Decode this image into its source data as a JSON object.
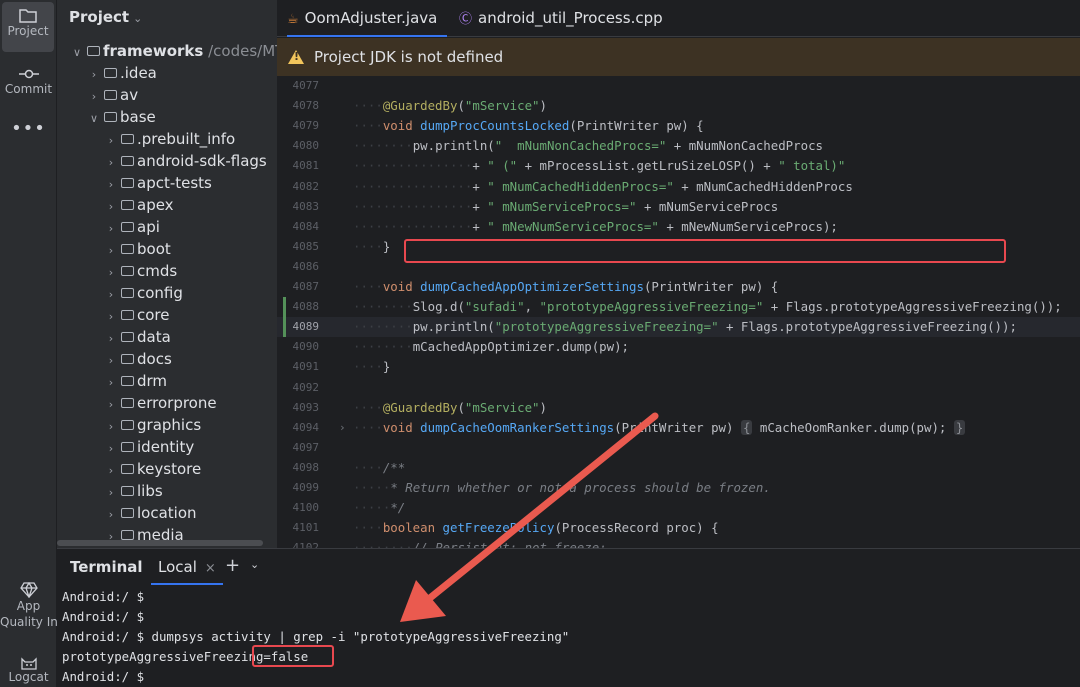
{
  "toolstrip": {
    "project_label": "Project",
    "commit_label": "Commit",
    "more_label": "•••",
    "aqi_label_1": "App",
    "aqi_label_2": "Quality Ins",
    "logcat_label": "Logcat"
  },
  "project": {
    "header": "Project",
    "chevron": "⌄",
    "tree": [
      {
        "label": "frameworks",
        "path": "/codes/MTK",
        "expanded": true,
        "bold": true
      },
      {
        "label": ".idea",
        "expanded": false
      },
      {
        "label": "av",
        "expanded": false
      },
      {
        "label": "base",
        "expanded": true
      },
      {
        "label": ".prebuilt_info",
        "expanded": false
      },
      {
        "label": "android-sdk-flags",
        "expanded": false
      },
      {
        "label": "apct-tests",
        "expanded": false
      },
      {
        "label": "apex",
        "expanded": false
      },
      {
        "label": "api",
        "expanded": false
      },
      {
        "label": "boot",
        "expanded": false
      },
      {
        "label": "cmds",
        "expanded": false
      },
      {
        "label": "config",
        "expanded": false
      },
      {
        "label": "core",
        "expanded": false
      },
      {
        "label": "data",
        "expanded": false
      },
      {
        "label": "docs",
        "expanded": false
      },
      {
        "label": "drm",
        "expanded": false
      },
      {
        "label": "errorprone",
        "expanded": false
      },
      {
        "label": "graphics",
        "expanded": false
      },
      {
        "label": "identity",
        "expanded": false
      },
      {
        "label": "keystore",
        "expanded": false
      },
      {
        "label": "libs",
        "expanded": false
      },
      {
        "label": "location",
        "expanded": false
      },
      {
        "label": "media",
        "expanded": false
      }
    ]
  },
  "editor": {
    "tabs": [
      {
        "label": "OomAdjuster.java",
        "active": true
      },
      {
        "label": "android_util_Process.cpp",
        "active": false
      }
    ],
    "banner": "Project JDK is not defined",
    "current_line": "4089",
    "changed_lines": [
      "4088",
      "4089"
    ],
    "lines": [
      {
        "num": "4077",
        "html": ""
      },
      {
        "num": "4078",
        "html": "<span class='dots'>····</span><span class='a'>@GuardedBy</span>(<span class='s'>\"mService\"</span>)"
      },
      {
        "num": "4079",
        "html": "<span class='dots'>····</span><span class='k'>void</span> <span class='f'>dumpProcCountsLocked</span>(PrintWriter pw) {"
      },
      {
        "num": "4080",
        "html": "<span class='dots'>········</span>pw.println(<span class='s'>\"  mNumNonCachedProcs=\"</span> + mNumNonCachedProcs"
      },
      {
        "num": "4081",
        "html": "<span class='dots'>················</span>+ <span class='s'>\" (\"</span> + mProcessList.getLruSizeLOSP() + <span class='s'>\" total)\"</span>"
      },
      {
        "num": "4082",
        "html": "<span class='dots'>················</span>+ <span class='s'>\" mNumCachedHiddenProcs=\"</span> + mNumCachedHiddenProcs"
      },
      {
        "num": "4083",
        "html": "<span class='dots'>················</span>+ <span class='s'>\" mNumServiceProcs=\"</span> + mNumServiceProcs"
      },
      {
        "num": "4084",
        "html": "<span class='dots'>················</span>+ <span class='s'>\" mNewNumServiceProcs=\"</span> + mNewNumServiceProcs);"
      },
      {
        "num": "4085",
        "html": "<span class='dots'>····</span>}"
      },
      {
        "num": "4086",
        "html": ""
      },
      {
        "num": "4087",
        "html": "<span class='dots'>····</span><span class='k'>void</span> <span class='f'>dumpCachedAppOptimizerSettings</span>(PrintWriter pw) {"
      },
      {
        "num": "4088",
        "html": "<span class='dots'>········</span>Slog.d(<span class='s'>\"sufadi\"</span>, <span class='s'>\"prototypeAggressiveFreezing=\"</span> + Flags.prototypeAggressiveFreezing());"
      },
      {
        "num": "4089",
        "html": "<span class='dots'>········</span>pw.println(<span class='s'>\"prototypeAggressiveFreezing=\"</span> + Flags.prototypeAggressiveFreezing());"
      },
      {
        "num": "4090",
        "html": "<span class='dots'>········</span>mCachedAppOptimizer.dump(pw);"
      },
      {
        "num": "4091",
        "html": "<span class='dots'>····</span>}"
      },
      {
        "num": "4092",
        "html": ""
      },
      {
        "num": "4093",
        "html": "<span class='dots'>····</span><span class='a'>@GuardedBy</span>(<span class='s'>\"mService\"</span>)"
      },
      {
        "num": "4094",
        "html": "<span class='dots'>····</span><span class='k'>void</span> <span class='f'>dumpCacheOomRankerSettings</span>(PrintWriter pw) <span class='inlay'>{</span> mCacheOomRanker.dump(pw); <span class='inlay'>}</span>"
      },
      {
        "num": "4097",
        "html": ""
      },
      {
        "num": "4098",
        "html": "<span class='dots'>····</span><span class='c'>/**</span>"
      },
      {
        "num": "4099",
        "html": "<span class='dots'>·····</span><span class='c'>* Return whether or not a process should be frozen.</span>"
      },
      {
        "num": "4100",
        "html": "<span class='dots'>·····</span><span class='c'>*/</span>"
      },
      {
        "num": "4101",
        "html": "<span class='dots'>····</span><span class='k'>boolean</span> <span class='f'>getFreezePolicy</span>(ProcessRecord proc) {"
      },
      {
        "num": "4102",
        "html": "<span class='dots'>········</span><span class='c'>// Persistent: not freeze;</span>"
      }
    ]
  },
  "terminal": {
    "title": "Terminal",
    "tab_label": "Local",
    "tab_close": "×",
    "add_label": "+",
    "menu_label": "⌄",
    "lines": [
      "Android:/ $",
      "Android:/ $",
      "Android:/ $ dumpsys activity | grep -i \"prototypeAggressiveFreezing\"",
      "prototypeAggressiveFreezing=false",
      "Android:/ $"
    ]
  },
  "colors": {
    "highlight_box": "#e8484f",
    "arrow": "#ea5a4f",
    "change_marker": "#549159",
    "accent": "#3574f0"
  }
}
